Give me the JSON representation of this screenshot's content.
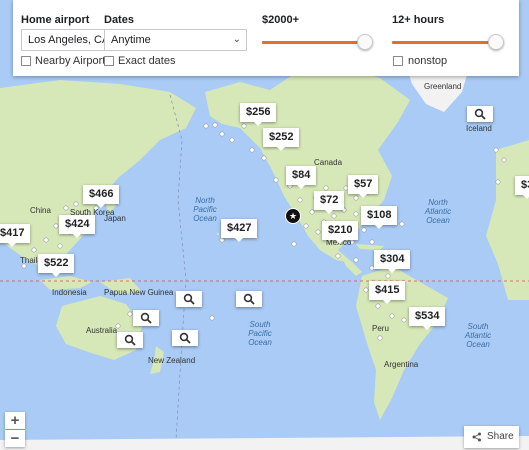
{
  "filters": {
    "home_airport_label": "Home airport",
    "home_airport_value": "Los Angeles, CA (L",
    "dates_label": "Dates",
    "dates_value": "Anytime",
    "nearby_airports_label": "Nearby Airports",
    "exact_dates_label": "Exact dates",
    "price_label": "$2000+",
    "duration_label": "12+ hours",
    "nonstop_label": "nonstop",
    "price_slider_fraction": 1.0,
    "duration_slider_fraction": 1.0
  },
  "prices": [
    {
      "id": "alaska",
      "label": "$256"
    },
    {
      "id": "west-canada",
      "label": "$252"
    },
    {
      "id": "mountain-west",
      "label": "$84"
    },
    {
      "id": "central-us",
      "label": "$72"
    },
    {
      "id": "northeast-us",
      "label": "$57"
    },
    {
      "id": "east-us",
      "label": "$108"
    },
    {
      "id": "south-us",
      "label": "$210"
    },
    {
      "id": "hawaii",
      "label": "$427"
    },
    {
      "id": "caribbean",
      "label": "$304"
    },
    {
      "id": "northern-south-america",
      "label": "$415"
    },
    {
      "id": "brazil",
      "label": "$534"
    },
    {
      "id": "japan",
      "label": "$466"
    },
    {
      "id": "east-china",
      "label": "$424"
    },
    {
      "id": "southeast-asia",
      "label": "$522"
    },
    {
      "id": "india-edge",
      "label": "$417"
    },
    {
      "id": "europe-edge",
      "label": "$3"
    }
  ],
  "map_labels": {
    "greenland": "Greenland",
    "iceland": "Iceland",
    "canada": "Canada",
    "china": "China",
    "south_korea": "South Korea",
    "japan": "Japan",
    "thailand": "Thailand",
    "indonesia": "Indonesia",
    "papua_new_guinea": "Papua New Guinea",
    "australia": "Australia",
    "new_zealand": "New Zealand",
    "mexico": "Mexico",
    "peru": "Peru",
    "argentina": "Argentina",
    "north_pacific": "North Pacific Ocean",
    "south_pacific": "South Pacific Ocean",
    "north_atlantic": "North Atlantic Ocean",
    "south_atlantic": "South Atlantic Ocean",
    "home_marker": "★"
  },
  "controls": {
    "zoom_in": "+",
    "zoom_out": "−",
    "share": "Share"
  },
  "colors": {
    "ocean": "#a9cbf5",
    "land": "#d6e8b8",
    "ice": "#f2f2f2",
    "slider": "#e0702b"
  },
  "icons": [
    "search-icon",
    "share-icon",
    "home-star-icon"
  ]
}
